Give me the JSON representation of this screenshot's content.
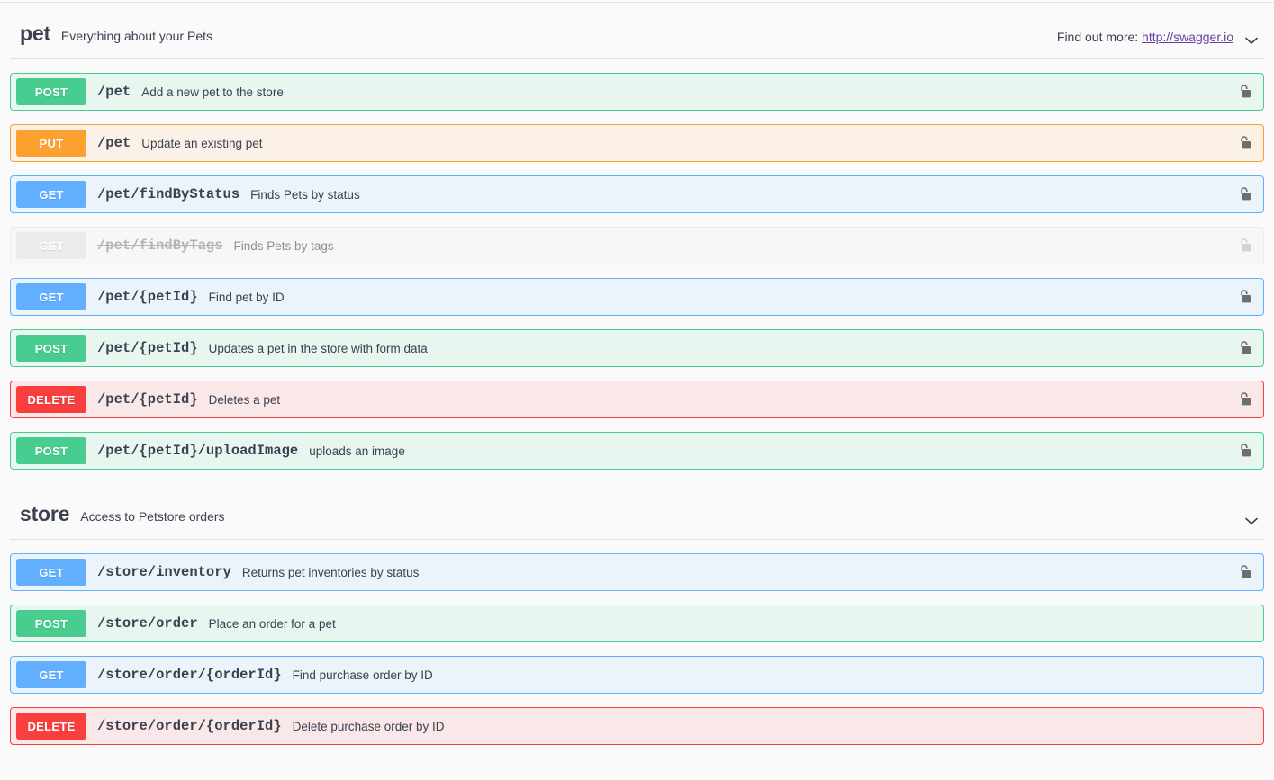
{
  "sections": [
    {
      "id": "pet",
      "name": "pet",
      "description": "Everything about your Pets",
      "external_docs_label": "Find out more:",
      "external_docs_link": "http://swagger.io",
      "collapse_icon": "chevron-down-icon",
      "operations": [
        {
          "method": "POST",
          "style": "post",
          "path": "/pet",
          "summary": "Add a new pet to the store",
          "lock": "unlocked-padlock-icon",
          "deprecated": false
        },
        {
          "method": "PUT",
          "style": "put",
          "path": "/pet",
          "summary": "Update an existing pet",
          "lock": "unlocked-padlock-icon",
          "deprecated": false
        },
        {
          "method": "GET",
          "style": "get",
          "path": "/pet/findByStatus",
          "summary": "Finds Pets by status",
          "lock": "unlocked-padlock-icon",
          "deprecated": false
        },
        {
          "method": "GET",
          "style": "dep",
          "path": "/pet/findByTags",
          "summary": "Finds Pets by tags",
          "lock": "unlocked-padlock-icon",
          "deprecated": true
        },
        {
          "method": "GET",
          "style": "get",
          "path": "/pet/{petId}",
          "summary": "Find pet by ID",
          "lock": "unlocked-padlock-icon",
          "deprecated": false
        },
        {
          "method": "POST",
          "style": "post",
          "path": "/pet/{petId}",
          "summary": "Updates a pet in the store with form data",
          "lock": "unlocked-padlock-icon",
          "deprecated": false
        },
        {
          "method": "DELETE",
          "style": "delete",
          "path": "/pet/{petId}",
          "summary": "Deletes a pet",
          "lock": "unlocked-padlock-icon",
          "deprecated": false
        },
        {
          "method": "POST",
          "style": "post",
          "path": "/pet/{petId}/uploadImage",
          "summary": "uploads an image",
          "lock": "unlocked-padlock-icon",
          "deprecated": false
        }
      ]
    },
    {
      "id": "store",
      "name": "store",
      "description": "Access to Petstore orders",
      "external_docs_label": "",
      "external_docs_link": "",
      "collapse_icon": "chevron-down-icon",
      "operations": [
        {
          "method": "GET",
          "style": "get",
          "path": "/store/inventory",
          "summary": "Returns pet inventories by status",
          "lock": "unlocked-padlock-icon",
          "deprecated": false
        },
        {
          "method": "POST",
          "style": "post",
          "path": "/store/order",
          "summary": "Place an order for a pet",
          "lock": "",
          "deprecated": false
        },
        {
          "method": "GET",
          "style": "get",
          "path": "/store/order/{orderId}",
          "summary": "Find purchase order by ID",
          "lock": "",
          "deprecated": false
        },
        {
          "method": "DELETE",
          "style": "delete",
          "path": "/store/order/{orderId}",
          "summary": "Delete purchase order by ID",
          "lock": "",
          "deprecated": false
        }
      ]
    }
  ],
  "colors": {
    "post": "#49cc90",
    "put": "#fca130",
    "get": "#61affe",
    "delete": "#f93e3e",
    "deprecated": "#ebebeb",
    "text": "#3b4151",
    "link": "#6b3fa0",
    "page_background": "#fafafa"
  }
}
